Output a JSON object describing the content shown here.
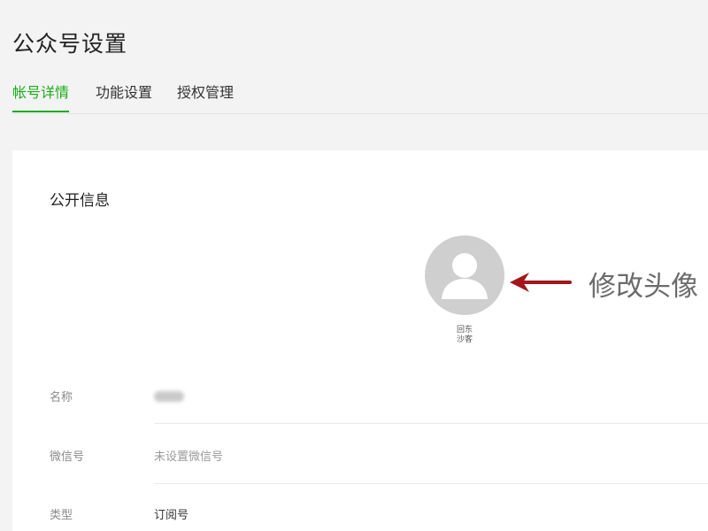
{
  "page": {
    "title": "公众号设置"
  },
  "tabs": [
    {
      "label": "帐号详情",
      "active": true
    },
    {
      "label": "功能设置",
      "active": false
    },
    {
      "label": "授权管理",
      "active": false
    }
  ],
  "public_info": {
    "section_title": "公开信息",
    "avatar": {
      "icon": "user-silhouette-icon",
      "qr_label_line1": "回东",
      "qr_label_line2": "沙客"
    },
    "annotation": "修改头像",
    "rows": [
      {
        "label": "名称",
        "value": "",
        "redacted": true
      },
      {
        "label": "微信号",
        "value": "未设置微信号"
      },
      {
        "label": "类型",
        "value": "订阅号"
      }
    ]
  },
  "colors": {
    "accent_green": "#1aad19",
    "annotation_arrow": "#a3161c",
    "avatar_bg": "#cfcfcf",
    "page_bg": "#f3f3f3"
  }
}
